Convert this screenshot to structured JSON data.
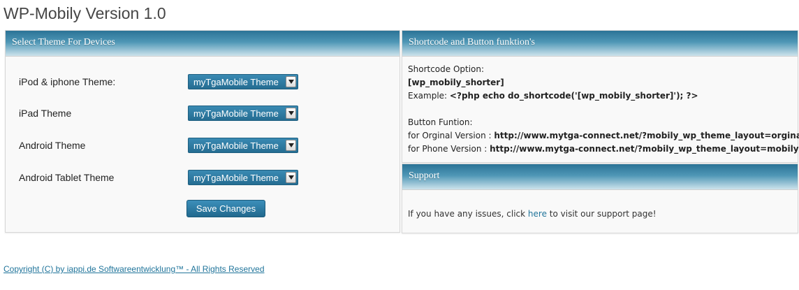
{
  "page": {
    "title": "WP-Mobily Version 1.0"
  },
  "themes_box": {
    "header": "Select Theme For Devices",
    "rows": [
      {
        "label": "iPod & iphone Theme:",
        "selected": "myTgaMobile Theme"
      },
      {
        "label": "iPad Theme",
        "selected": "myTgaMobile Theme"
      },
      {
        "label": "Android Theme",
        "selected": "myTgaMobile Theme"
      },
      {
        "label": "Android Tablet Theme",
        "selected": "myTgaMobile Theme"
      }
    ],
    "save_label": "Save Changes"
  },
  "shortcode_box": {
    "header": "Shortcode and Button funktion's",
    "option_label": "Shortcode Option:",
    "shortcode": "[wp_mobily_shorter]",
    "example_label": "Example: ",
    "example_code": "<?php echo do_shortcode('[wp_mobily_shorter]'); ?>",
    "button_label": "Button Funtion:",
    "orginal_label": "for Orginal Version : ",
    "orginal_url": "http://www.mytga-connect.net/?mobily_wp_theme_layout=orginal",
    "phone_label": "for Phone Version : ",
    "phone_url": "http://www.mytga-connect.net/?mobily_wp_theme_layout=mobily"
  },
  "support_box": {
    "header": "Support",
    "text_before": "If you have any issues, click ",
    "link": "here",
    "text_after": " to visit our support page!"
  },
  "footer": {
    "copyright": "Copyright (C) by iappi.de Softwareentwicklung™ - All Rights Reserved"
  },
  "colors": {
    "accent": "#21759b",
    "header_dark": "#2b7396",
    "button": "#256d92"
  }
}
